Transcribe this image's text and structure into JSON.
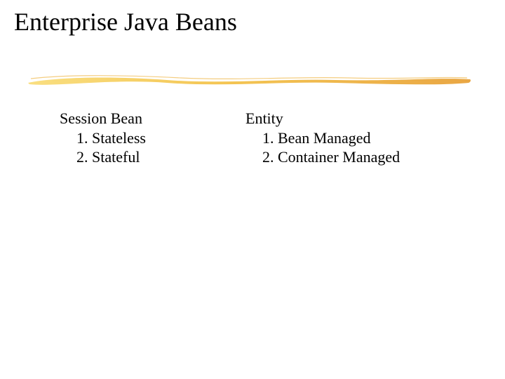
{
  "title": "Enterprise Java Beans",
  "left": {
    "heading": "Session Bean",
    "item1": "1. Stateless",
    "item2": "2. Stateful"
  },
  "right": {
    "heading": "Entity",
    "item1": "1. Bean Managed",
    "item2": "2. Container  Managed"
  },
  "colors": {
    "accent_yellow": "#f6c94a",
    "accent_orange": "#e8a23a"
  }
}
